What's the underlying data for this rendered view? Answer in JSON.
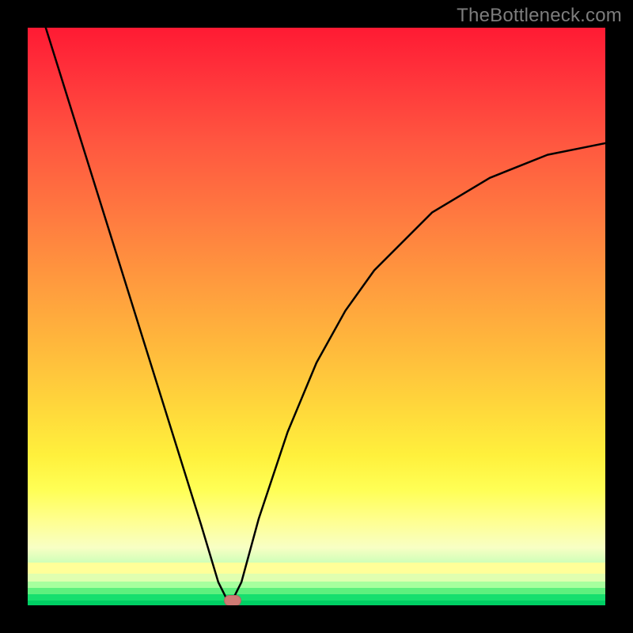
{
  "attribution": "TheBottleneck.com",
  "marker": {
    "x_frac": 0.355,
    "y_frac": 0.992
  },
  "chart_data": {
    "type": "line",
    "title": "",
    "xlabel": "",
    "ylabel": "",
    "xlim": [
      0,
      1
    ],
    "ylim": [
      0,
      1
    ],
    "series": [
      {
        "name": "curve",
        "x": [
          0.0,
          0.05,
          0.1,
          0.15,
          0.2,
          0.25,
          0.3,
          0.33,
          0.35,
          0.37,
          0.4,
          0.45,
          0.5,
          0.55,
          0.6,
          0.65,
          0.7,
          0.75,
          0.8,
          0.85,
          0.9,
          0.95,
          1.0
        ],
        "y": [
          1.1,
          0.94,
          0.78,
          0.62,
          0.46,
          0.3,
          0.14,
          0.04,
          0.0,
          0.04,
          0.15,
          0.3,
          0.42,
          0.51,
          0.58,
          0.63,
          0.68,
          0.71,
          0.74,
          0.76,
          0.78,
          0.79,
          0.8
        ]
      }
    ],
    "background_gradient": {
      "direction": "top-to-bottom",
      "stops": [
        {
          "pos": 0.0,
          "color": "#ff1a33"
        },
        {
          "pos": 0.5,
          "color": "#ffa53d"
        },
        {
          "pos": 0.8,
          "color": "#ffff55"
        },
        {
          "pos": 1.0,
          "color": "#00d66a"
        }
      ]
    },
    "marker_point": {
      "x": 0.355,
      "y": 0.008,
      "color": "#cf7a74"
    }
  }
}
